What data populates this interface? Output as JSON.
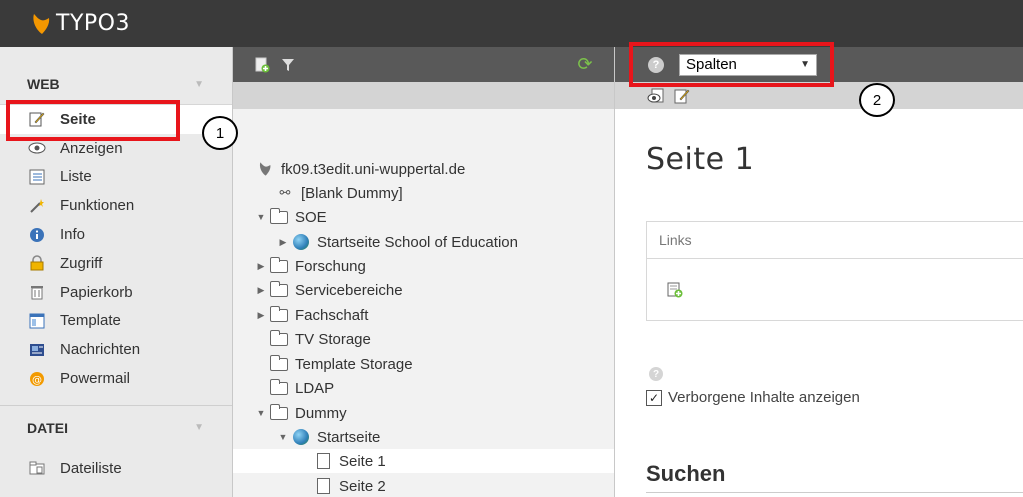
{
  "app": {
    "title": "TYPO3"
  },
  "module_menu": {
    "groups": [
      {
        "label": "WEB",
        "items": [
          {
            "label": "Seite",
            "icon": "edit-page-icon",
            "active": true
          },
          {
            "label": "Anzeigen",
            "icon": "eye-icon"
          },
          {
            "label": "Liste",
            "icon": "list-icon"
          },
          {
            "label": "Funktionen",
            "icon": "wand-icon"
          },
          {
            "label": "Info",
            "icon": "info-icon"
          },
          {
            "label": "Zugriff",
            "icon": "lock-icon"
          },
          {
            "label": "Papierkorb",
            "icon": "trash-icon"
          },
          {
            "label": "Template",
            "icon": "template-icon"
          },
          {
            "label": "Nachrichten",
            "icon": "news-icon"
          },
          {
            "label": "Powermail",
            "icon": "powermail-icon"
          }
        ]
      },
      {
        "label": "DATEI",
        "items": [
          {
            "label": "Dateiliste",
            "icon": "filelist-icon"
          }
        ]
      }
    ]
  },
  "page_tree": {
    "root": "fk09.t3edit.uni-wuppertal.de",
    "nodes": [
      {
        "label": "[Blank Dummy]"
      },
      {
        "label": "SOE"
      },
      {
        "label": "Startseite School of Education"
      },
      {
        "label": "Forschung"
      },
      {
        "label": "Servicebereiche"
      },
      {
        "label": "Fachschaft"
      },
      {
        "label": "TV Storage"
      },
      {
        "label": "Template Storage"
      },
      {
        "label": "LDAP"
      },
      {
        "label": "Dummy"
      },
      {
        "label": "Startseite"
      },
      {
        "label": "Seite 1"
      },
      {
        "label": "Seite 2"
      }
    ]
  },
  "content": {
    "view_select": {
      "value": "Spalten"
    },
    "page_title": "Seite 1",
    "column_label": "Links",
    "hidden_checkbox_label": "Verborgene Inhalte anzeigen",
    "hidden_checked": true,
    "search_heading": "Suchen"
  },
  "annotations": [
    "1",
    "2"
  ],
  "colors": {
    "accent_red": "#e8151b",
    "typo3_orange": "#f49700",
    "topbar": "#3a3a3a",
    "toolbar": "#595959"
  }
}
